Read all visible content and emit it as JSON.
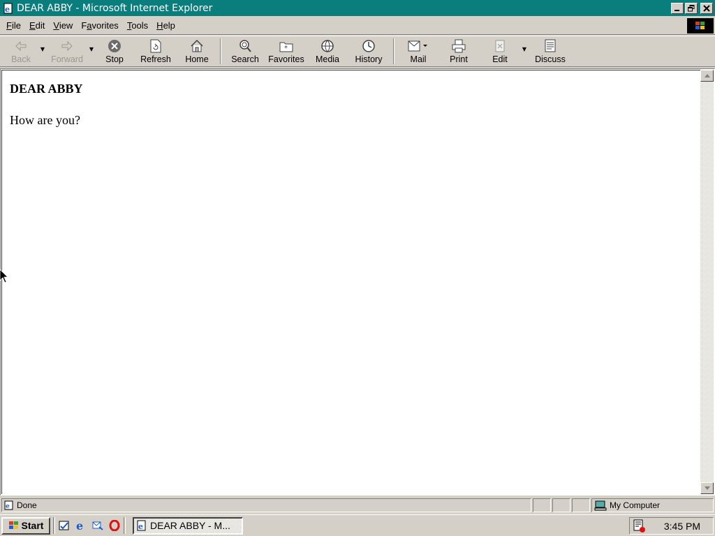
{
  "window": {
    "title": "DEAR ABBY - Microsoft Internet Explorer",
    "controls": {
      "minimize": "_",
      "restore": "❐",
      "close": "✕"
    }
  },
  "menu": [
    {
      "label": "File",
      "accel": "F",
      "rest": "ile"
    },
    {
      "label": "Edit",
      "accel": "E",
      "rest": "dit"
    },
    {
      "label": "View",
      "accel": "V",
      "rest": "iew"
    },
    {
      "label": "Favorites",
      "accel": "a",
      "pre": "F",
      "rest": "vorites"
    },
    {
      "label": "Tools",
      "accel": "T",
      "rest": "ools"
    },
    {
      "label": "Help",
      "accel": "H",
      "rest": "elp"
    }
  ],
  "toolbar": {
    "back": "Back",
    "forward": "Forward",
    "stop": "Stop",
    "refresh": "Refresh",
    "home": "Home",
    "search": "Search",
    "favorites": "Favorites",
    "media": "Media",
    "history": "History",
    "mail": "Mail",
    "print": "Print",
    "edit": "Edit",
    "discuss": "Discuss"
  },
  "page": {
    "heading": "DEAR ABBY",
    "body": "How are you?"
  },
  "status": {
    "text": "Done",
    "zone": "My Computer"
  },
  "taskbar": {
    "start": "Start",
    "task": "DEAR ABBY - M...",
    "clock": "3:45 PM"
  },
  "colors": {
    "titlebar": "#0a7d7d",
    "face": "#d4d0c8"
  }
}
